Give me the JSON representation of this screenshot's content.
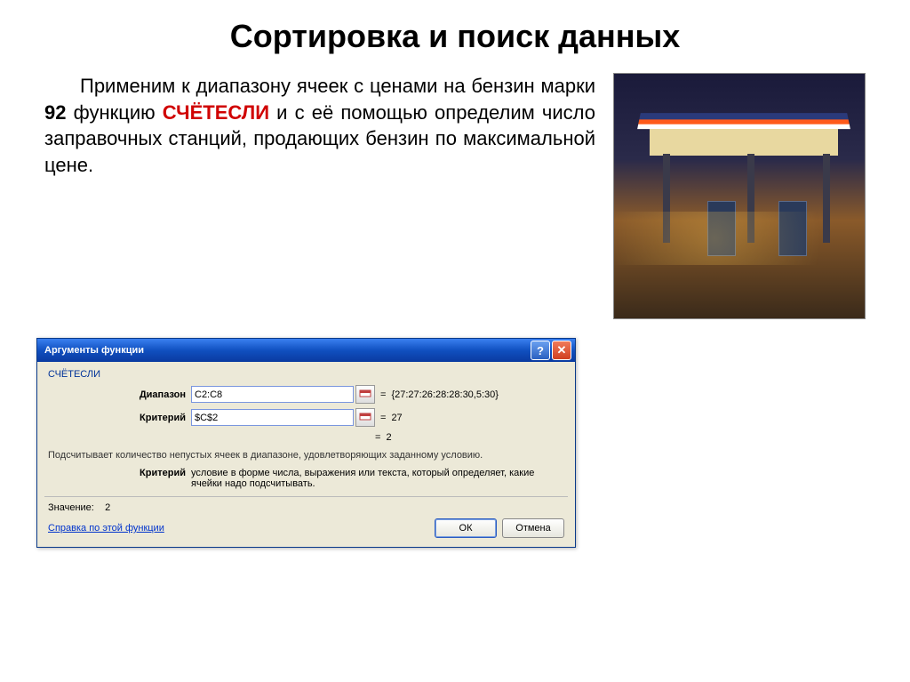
{
  "slide": {
    "title": "Сортировка и поиск данных",
    "paragraph_parts": {
      "p1": "Применим к диапазону ячеек с ценами на бензин марки ",
      "bold1": "92",
      "p2": " функцию ",
      "red": "СЧЁТЕСЛИ",
      "p3": " и с её помощью определим число заправочных станций, продающих бензин по максимальной цене."
    }
  },
  "image": {
    "name": "gas-station-photo"
  },
  "dialog": {
    "title": "Аргументы функции",
    "function_name": "СЧЁТЕСЛИ",
    "args": {
      "range_label": "Диапазон",
      "range_value": "C2:C8",
      "range_preview": "{27:27:26:28:28:30,5:30}",
      "criteria_label": "Критерий",
      "criteria_value": "$C$2",
      "criteria_preview": "27"
    },
    "result_preview": "2",
    "description": "Подсчитывает количество непустых ячеек в диапазоне, удовлетворяющих заданному условию.",
    "arg_help_label": "Критерий",
    "arg_help_text": "условие в форме числа, выражения или текста, который определяет, какие ячейки надо подсчитывать.",
    "value_label": "Значение:",
    "value_result": "2",
    "help_link": "Справка по этой функции",
    "ok": "ОК",
    "cancel": "Отмена",
    "eq": "="
  }
}
